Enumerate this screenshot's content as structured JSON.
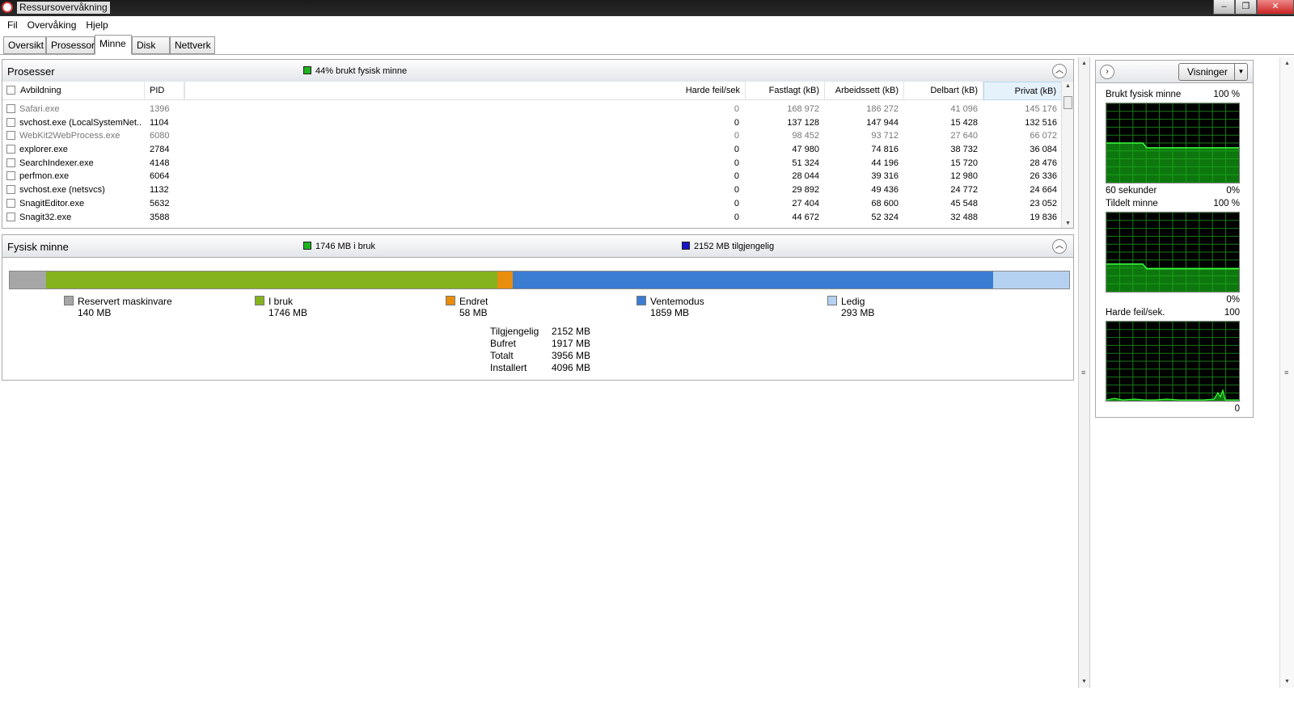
{
  "window": {
    "title": "Ressursovervåkning"
  },
  "menu": [
    "Fil",
    "Overvåking",
    "Hjelp"
  ],
  "tabs": [
    "Oversikt",
    "Prosessor",
    "Minne",
    "Disk",
    "Nettverk"
  ],
  "active_tab": "Minne",
  "processes": {
    "title": "Prosesser",
    "summary": "44% brukt fysisk minne",
    "summary_color": "#1db31d",
    "columns": [
      "Avbildning",
      "PID",
      "Harde feil/sek",
      "Fastlagt (kB)",
      "Arbeidssett (kB)",
      "Delbart (kB)",
      "Privat (kB)"
    ],
    "rows": [
      {
        "name": "Safari.exe",
        "pid": "1396",
        "faults": "0",
        "commit": "168 972",
        "working": "186 272",
        "shareable": "41 096",
        "private": "145 176",
        "greyed": true
      },
      {
        "name": "svchost.exe (LocalSystemNet...",
        "pid": "1104",
        "faults": "0",
        "commit": "137 128",
        "working": "147 944",
        "shareable": "15 428",
        "private": "132 516",
        "greyed": false
      },
      {
        "name": "WebKit2WebProcess.exe",
        "pid": "6080",
        "faults": "0",
        "commit": "98 452",
        "working": "93 712",
        "shareable": "27 640",
        "private": "66 072",
        "greyed": true
      },
      {
        "name": "explorer.exe",
        "pid": "2784",
        "faults": "0",
        "commit": "47 980",
        "working": "74 816",
        "shareable": "38 732",
        "private": "36 084",
        "greyed": false
      },
      {
        "name": "SearchIndexer.exe",
        "pid": "4148",
        "faults": "0",
        "commit": "51 324",
        "working": "44 196",
        "shareable": "15 720",
        "private": "28 476",
        "greyed": false
      },
      {
        "name": "perfmon.exe",
        "pid": "6064",
        "faults": "0",
        "commit": "28 044",
        "working": "39 316",
        "shareable": "12 980",
        "private": "26 336",
        "greyed": false
      },
      {
        "name": "svchost.exe (netsvcs)",
        "pid": "1132",
        "faults": "0",
        "commit": "29 892",
        "working": "49 436",
        "shareable": "24 772",
        "private": "24 664",
        "greyed": false
      },
      {
        "name": "SnagitEditor.exe",
        "pid": "5632",
        "faults": "0",
        "commit": "27 404",
        "working": "68 600",
        "shareable": "45 548",
        "private": "23 052",
        "greyed": false
      },
      {
        "name": "Snagit32.exe",
        "pid": "3588",
        "faults": "0",
        "commit": "44 672",
        "working": "52 324",
        "shareable": "32 488",
        "private": "19 836",
        "greyed": false
      }
    ]
  },
  "physical_memory": {
    "title": "Fysisk minne",
    "in_use_label": "1746 MB i bruk",
    "in_use_color": "#1db31d",
    "available_label": "2152 MB tilgjengelig",
    "available_color": "#1515c8",
    "segments": [
      {
        "name": "Reservert maskinvare",
        "value": "140 MB",
        "mb": 140,
        "color": "#a6a6a6"
      },
      {
        "name": "I bruk",
        "value": "1746 MB",
        "mb": 1746,
        "color": "#84b31e"
      },
      {
        "name": "Endret",
        "value": "58 MB",
        "mb": 58,
        "color": "#e98d0c"
      },
      {
        "name": "Ventemodus",
        "value": "1859 MB",
        "mb": 1859,
        "color": "#3b7dd3"
      },
      {
        "name": "Ledig",
        "value": "293 MB",
        "mb": 293,
        "color": "#b5d1f1"
      }
    ],
    "stats": [
      {
        "label": "Tilgjengelig",
        "value": "2152 MB"
      },
      {
        "label": "Bufret",
        "value": "1917 MB"
      },
      {
        "label": "Totalt",
        "value": "3956 MB"
      },
      {
        "label": "Installert",
        "value": "4096 MB"
      }
    ]
  },
  "right_panel": {
    "views_button": "Visninger",
    "graphs": [
      {
        "title": "Brukt fysisk minne",
        "max": "100 %",
        "footer_left": "60 sekunder",
        "footer_right": "0%",
        "level": 0.44
      },
      {
        "title": "Tildelt minne",
        "max": "100 %",
        "footer_left": "",
        "footer_right": "0%",
        "level": 0.29
      },
      {
        "title": "Harde feil/sek.",
        "max": "100",
        "footer_left": "",
        "footer_right": "0",
        "level": 0.0
      }
    ]
  }
}
